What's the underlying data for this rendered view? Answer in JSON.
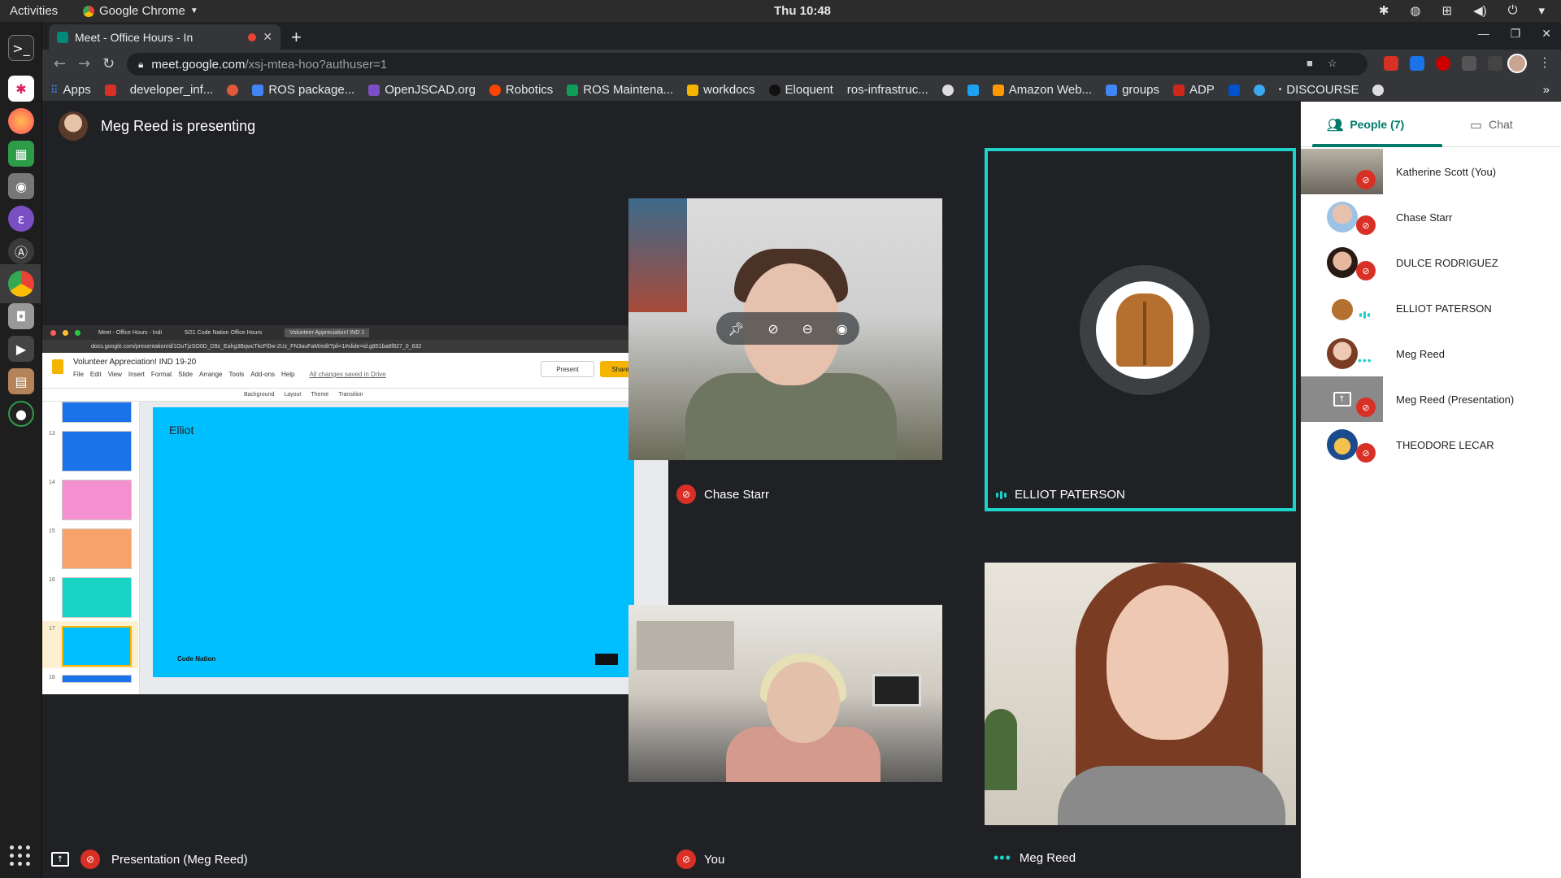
{
  "os": {
    "activities": "Activities",
    "app_name": "Google Chrome",
    "clock": "Thu 10:48"
  },
  "browser": {
    "tab_title": "Meet - Office Hours - In",
    "url_host": "meet.google.com",
    "url_path": "/xsj-mtea-hoo?authuser=1",
    "bookmarks": [
      "Apps",
      "developer_inf...",
      "ROS package...",
      "OpenJSCAD.org",
      "Robotics",
      "ROS Maintena...",
      "workdocs",
      "Eloquent",
      "ros-infrastruc...",
      "Amazon Web...",
      "groups",
      "ADP",
      "DISCOURSE"
    ]
  },
  "meet": {
    "presenter_banner": "Meg Reed is presenting",
    "presentation_label": "Presentation (Meg Reed)",
    "tiles": {
      "chase": "Chase Starr",
      "elliot": "ELLIOT PATERSON",
      "you": "You",
      "meg": "Meg Reed"
    }
  },
  "shared_screen": {
    "tabs": [
      "Meet - Office Hours - Indi",
      "5/21 Code Nation Office Hours",
      "Volunteer Appreciation! IND 1"
    ],
    "url": "docs.google.com/presentation/d/1OuTjzSO0D_D9z_Eahg3BqwcTkcFl0w-2Uz_FN3auFaM/edit?pli=1#slide=id.g851ba8f827_0_632",
    "doc_title": "Volunteer Appreciation! IND 19-20",
    "menu": [
      "File",
      "Edit",
      "View",
      "Insert",
      "Format",
      "Slide",
      "Arrange",
      "Tools",
      "Add-ons",
      "Help"
    ],
    "saved": "All changes saved in Drive",
    "present": "Present",
    "share": "Share",
    "toolbar": [
      "Background",
      "Layout",
      "Theme",
      "Transition"
    ],
    "slide_numbers": [
      "13",
      "14",
      "15",
      "16",
      "17",
      "18"
    ],
    "slide_title": "Elliot",
    "slide_footer": "Code Nation"
  },
  "people_panel": {
    "people_tab": "People (7)",
    "chat_tab": "Chat",
    "participants": [
      {
        "name": "Katherine Scott (You)",
        "status": "muted"
      },
      {
        "name": "Chase Starr",
        "status": "muted"
      },
      {
        "name": "DULCE RODRIGUEZ",
        "status": "muted"
      },
      {
        "name": "ELLIOT PATERSON",
        "status": "speaking"
      },
      {
        "name": "Meg Reed",
        "status": "active"
      },
      {
        "name": "Meg Reed (Presentation)",
        "status": "muted"
      },
      {
        "name": "THEODORE LECAR",
        "status": "muted"
      }
    ]
  },
  "colors": {
    "accent_teal": "#1dd3c9",
    "meet_green": "#00796b",
    "mute_red": "#d93025",
    "slide_blue": "#00bfff"
  }
}
